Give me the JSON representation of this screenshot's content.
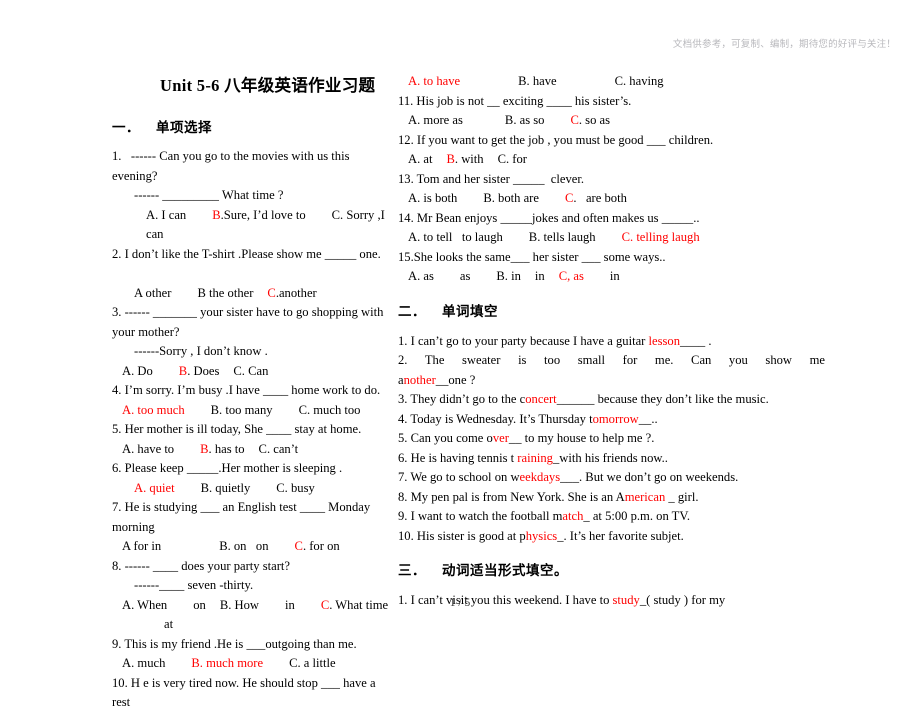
{
  "header": {
    "watermark": "文档供参考，可复制、编制，期待您的好评与关注！"
  },
  "title": "Unit 5-6  八年级英语作业习题",
  "footer": {
    "page_number": "1 / 5"
  },
  "colors": {
    "answer_red": "#ff0000",
    "watermark_gray": "#b9b9bd",
    "text_black": "#000000"
  },
  "sections": {
    "one": {
      "num": "一．",
      "label": "单项选择"
    },
    "two": {
      "num": "二．",
      "label": "单词填空"
    },
    "three": {
      "num": "三．",
      "label": "动词适当形式填空。"
    }
  },
  "left_column": {
    "lines": [
      "1.   ------ Can you go to the movies with us this evening?",
      "------ _________ What time ?",
      "A. I can",
      "B",
      ".Sure, I’d love to",
      "C. Sorry ,I can",
      "2. I don’t like the T-shirt .Please show me _____ one.",
      "A other",
      "B the other",
      "C",
      ".another",
      "3.  ------  _______  your  sister  have  to  go  shopping  with  your mother?",
      "------Sorry , I don’t know .",
      "A. Do",
      "B",
      ". Does",
      "C. Can",
      "4. I’m sorry. I’m busy .I have ____ home work to do.",
      "A",
      ". too much",
      "B. too many",
      "C. much too",
      "5. Her mother is ill today, She ____ stay at home.",
      "A. have to",
      "B",
      ". has to",
      "C. can’t",
      "6. Please keep _____.Her mother is sleeping .",
      "A",
      ". quiet",
      "B. quietly",
      "C. busy",
      "7. He is studying ___ an English test ____ Monday morning",
      "A for in",
      "B. on   on",
      "C",
      ". for on",
      "8. ------ ____ does your party start?",
      "------____ seven -thirty.",
      "A. When",
      "on",
      "B. How",
      "in",
      "C",
      ". What time",
      "at",
      "9. This is my friend .He is ___outgoing than me.",
      "A. much",
      "B",
      ". much more",
      "C. a little",
      "10. H e is very tired now. He should stop ___ have a rest"
    ]
  },
  "right_column": {
    "lines": [
      "A",
      ". to have",
      "B. have",
      "C. having",
      "11. His job is not __ exciting ____ his sister’s.",
      "A. more as",
      "B. as so",
      "C",
      ". so as",
      "12. If you want to get the job , you must be good ___ children.",
      "A. at",
      "B",
      ". with",
      "C. for",
      "13. Tom and her sister _____  clever.",
      "A. is both",
      "B. both are",
      "C",
      ".   are both",
      "14. Mr Bean enjoys _____jokes and often makes us _____..",
      "A. to tell   to laugh",
      "B. tells laugh",
      "C",
      ". telling laugh",
      "15.She looks the same___ her sister ___ some ways..",
      "A. as",
      "as",
      "B. in",
      "in",
      "C, as",
      "in"
    ]
  },
  "fill_in_words": {
    "items": [
      {
        "num": "1.",
        "pre": "I can’t go to your party because I have a guitar ",
        "answer": "lesson",
        "post": "____ ."
      },
      {
        "num": "2.",
        "pre": "The  sweater  is  too  small  for  me.  Can  you  show  me ",
        "answer_split_black": "a",
        "answer": "nother",
        "post": "__one ?"
      },
      {
        "num": "3.",
        "pre": "They didn’t go to the c",
        "answer": "oncert",
        "post": "______ because they don’t like the music."
      },
      {
        "num": "4.",
        "pre": "Today is Wednesday. It’s Thursday   t",
        "answer": "omorrow",
        "post": "__.."
      },
      {
        "num": "5.",
        "pre": "Can you come o",
        "answer": "ver",
        "post": "__ to my house to help me ?."
      },
      {
        "num": "6.",
        "pre": "He is having tennis t ",
        "answer": "raining",
        "post": "_with his friends now.."
      },
      {
        "num": "7.",
        "pre": "We go to school on w",
        "answer": "eekdays",
        "post": "___. But we don’t go on weekends."
      },
      {
        "num": "8.",
        "pre": "My pen pal is from New York. She is an A",
        "answer": "merican",
        "post": " _ girl."
      },
      {
        "num": "9.",
        "pre": "I want to watch the football m",
        "answer": "atch",
        "post": "_ at 5:00 p.m. on TV."
      },
      {
        "num": "10.",
        "pre": "His sister is good at p",
        "answer": "hysics",
        "post": "_. It’s her favorite subjet."
      }
    ]
  },
  "verb_forms": {
    "items": [
      {
        "num": "1.",
        "pre": "I can’t visit you this weekend. I have to ",
        "answer": "study",
        "post": "_( study ) for my"
      }
    ]
  }
}
